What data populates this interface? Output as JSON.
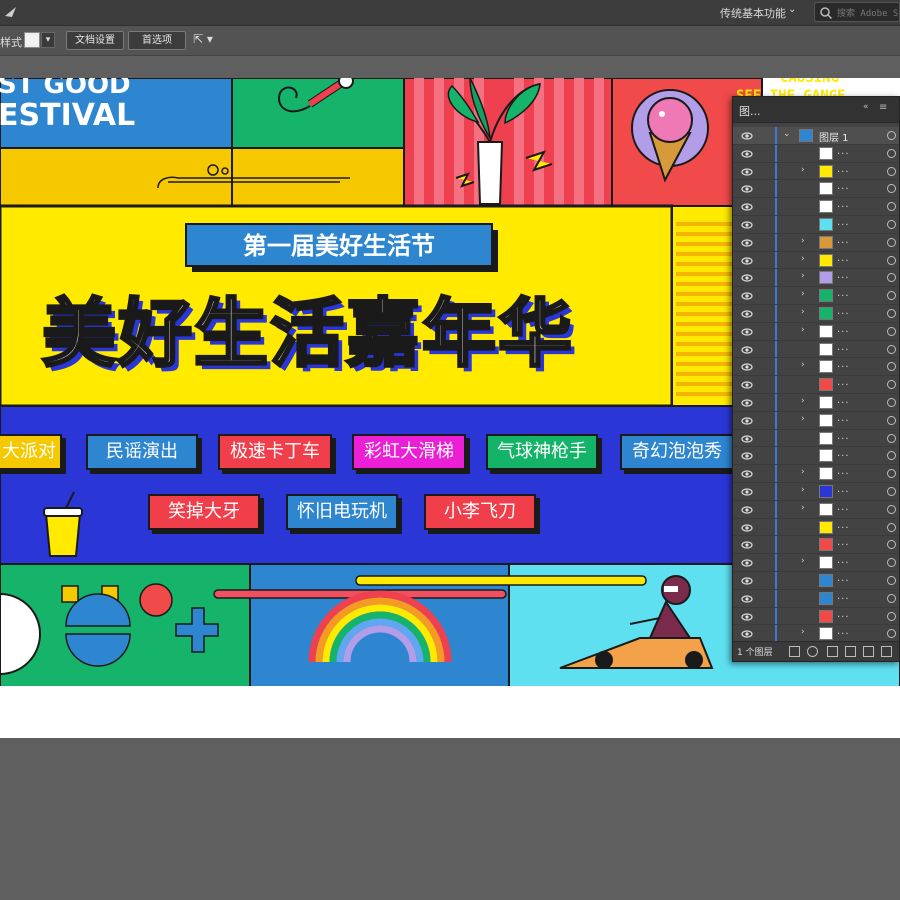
{
  "menubar": {
    "workspace_label": "传统基本功能",
    "search_placeholder": "搜索 Adobe Stock"
  },
  "controlbar": {
    "style_label": "样式：",
    "doc_setup_label": "文档设置",
    "preferences_label": "首选项"
  },
  "artwork": {
    "festival_line1": "ST GOOD",
    "festival_line2": "ESTIVAL",
    "top_right_line1": "CAUSING",
    "top_right_line2": "SEE THE GANGE",
    "subtitle": "第一届美好生活节",
    "headline": "美好生活嘉年华",
    "tags_row1": [
      "大派对",
      "民谣演出",
      "极速卡丁车",
      "彩虹大滑梯",
      "气球神枪手",
      "奇幻泡泡秀"
    ],
    "tags_row2": [
      "笑掉大牙",
      "怀旧电玩机",
      "小李飞刀"
    ],
    "colors": {
      "yellow": "#ffea00",
      "blue": "#2b36d6",
      "green": "#16b36b",
      "red": "#f04a4a",
      "cyan": "#5fe0f0",
      "tag_blue": "#2e86d1",
      "tag_red": "#f03e4a",
      "tag_magenta": "#ea1fd6",
      "tag_green": "#14b468",
      "tag_yellow": "#f5c800"
    }
  },
  "layers_panel": {
    "tab_label": "图...",
    "top_layer_name": "图层 1",
    "layer_count_label": "1 个图层"
  }
}
